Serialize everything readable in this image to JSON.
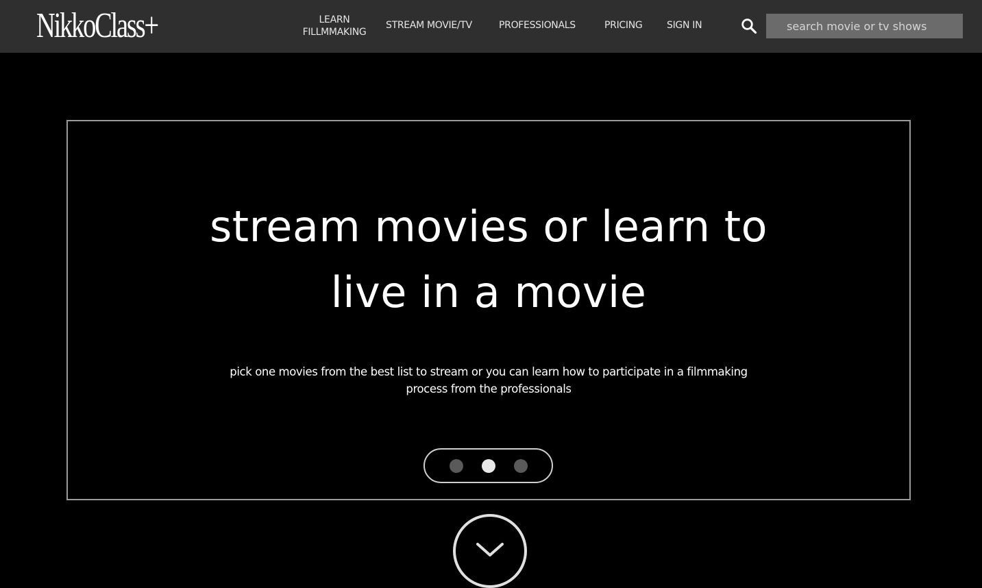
{
  "header": {
    "logo_text": "NikkoClass+",
    "nav": {
      "learn_line1": "LEARN",
      "learn_line2": "FILLMMAKING",
      "stream": "STREAM MOVIE/TV",
      "professionals": "PROFESSIONALS",
      "pricing": "PRICING",
      "sign_in": "SIGN IN"
    },
    "search": {
      "icon": "search-icon",
      "placeholder": "search movie or tv shows",
      "value": ""
    }
  },
  "hero": {
    "title_line1": "stream movies or learn to",
    "title_line2": "live in a movie",
    "subtitle_line1": "pick one movies from the best list to stream or you can learn how to participate in a filmmaking",
    "subtitle_line2": "process from the professionals",
    "carousel": {
      "slide_count": 3,
      "active_index": 1
    }
  },
  "scroll_button": {
    "icon": "chevron-down-icon"
  },
  "colors": {
    "header_bg": "#2f2f2f",
    "page_bg": "#000000",
    "search_bg": "#6b6b6b",
    "text": "#ffffff",
    "hero_border": "#9a9a9a"
  }
}
